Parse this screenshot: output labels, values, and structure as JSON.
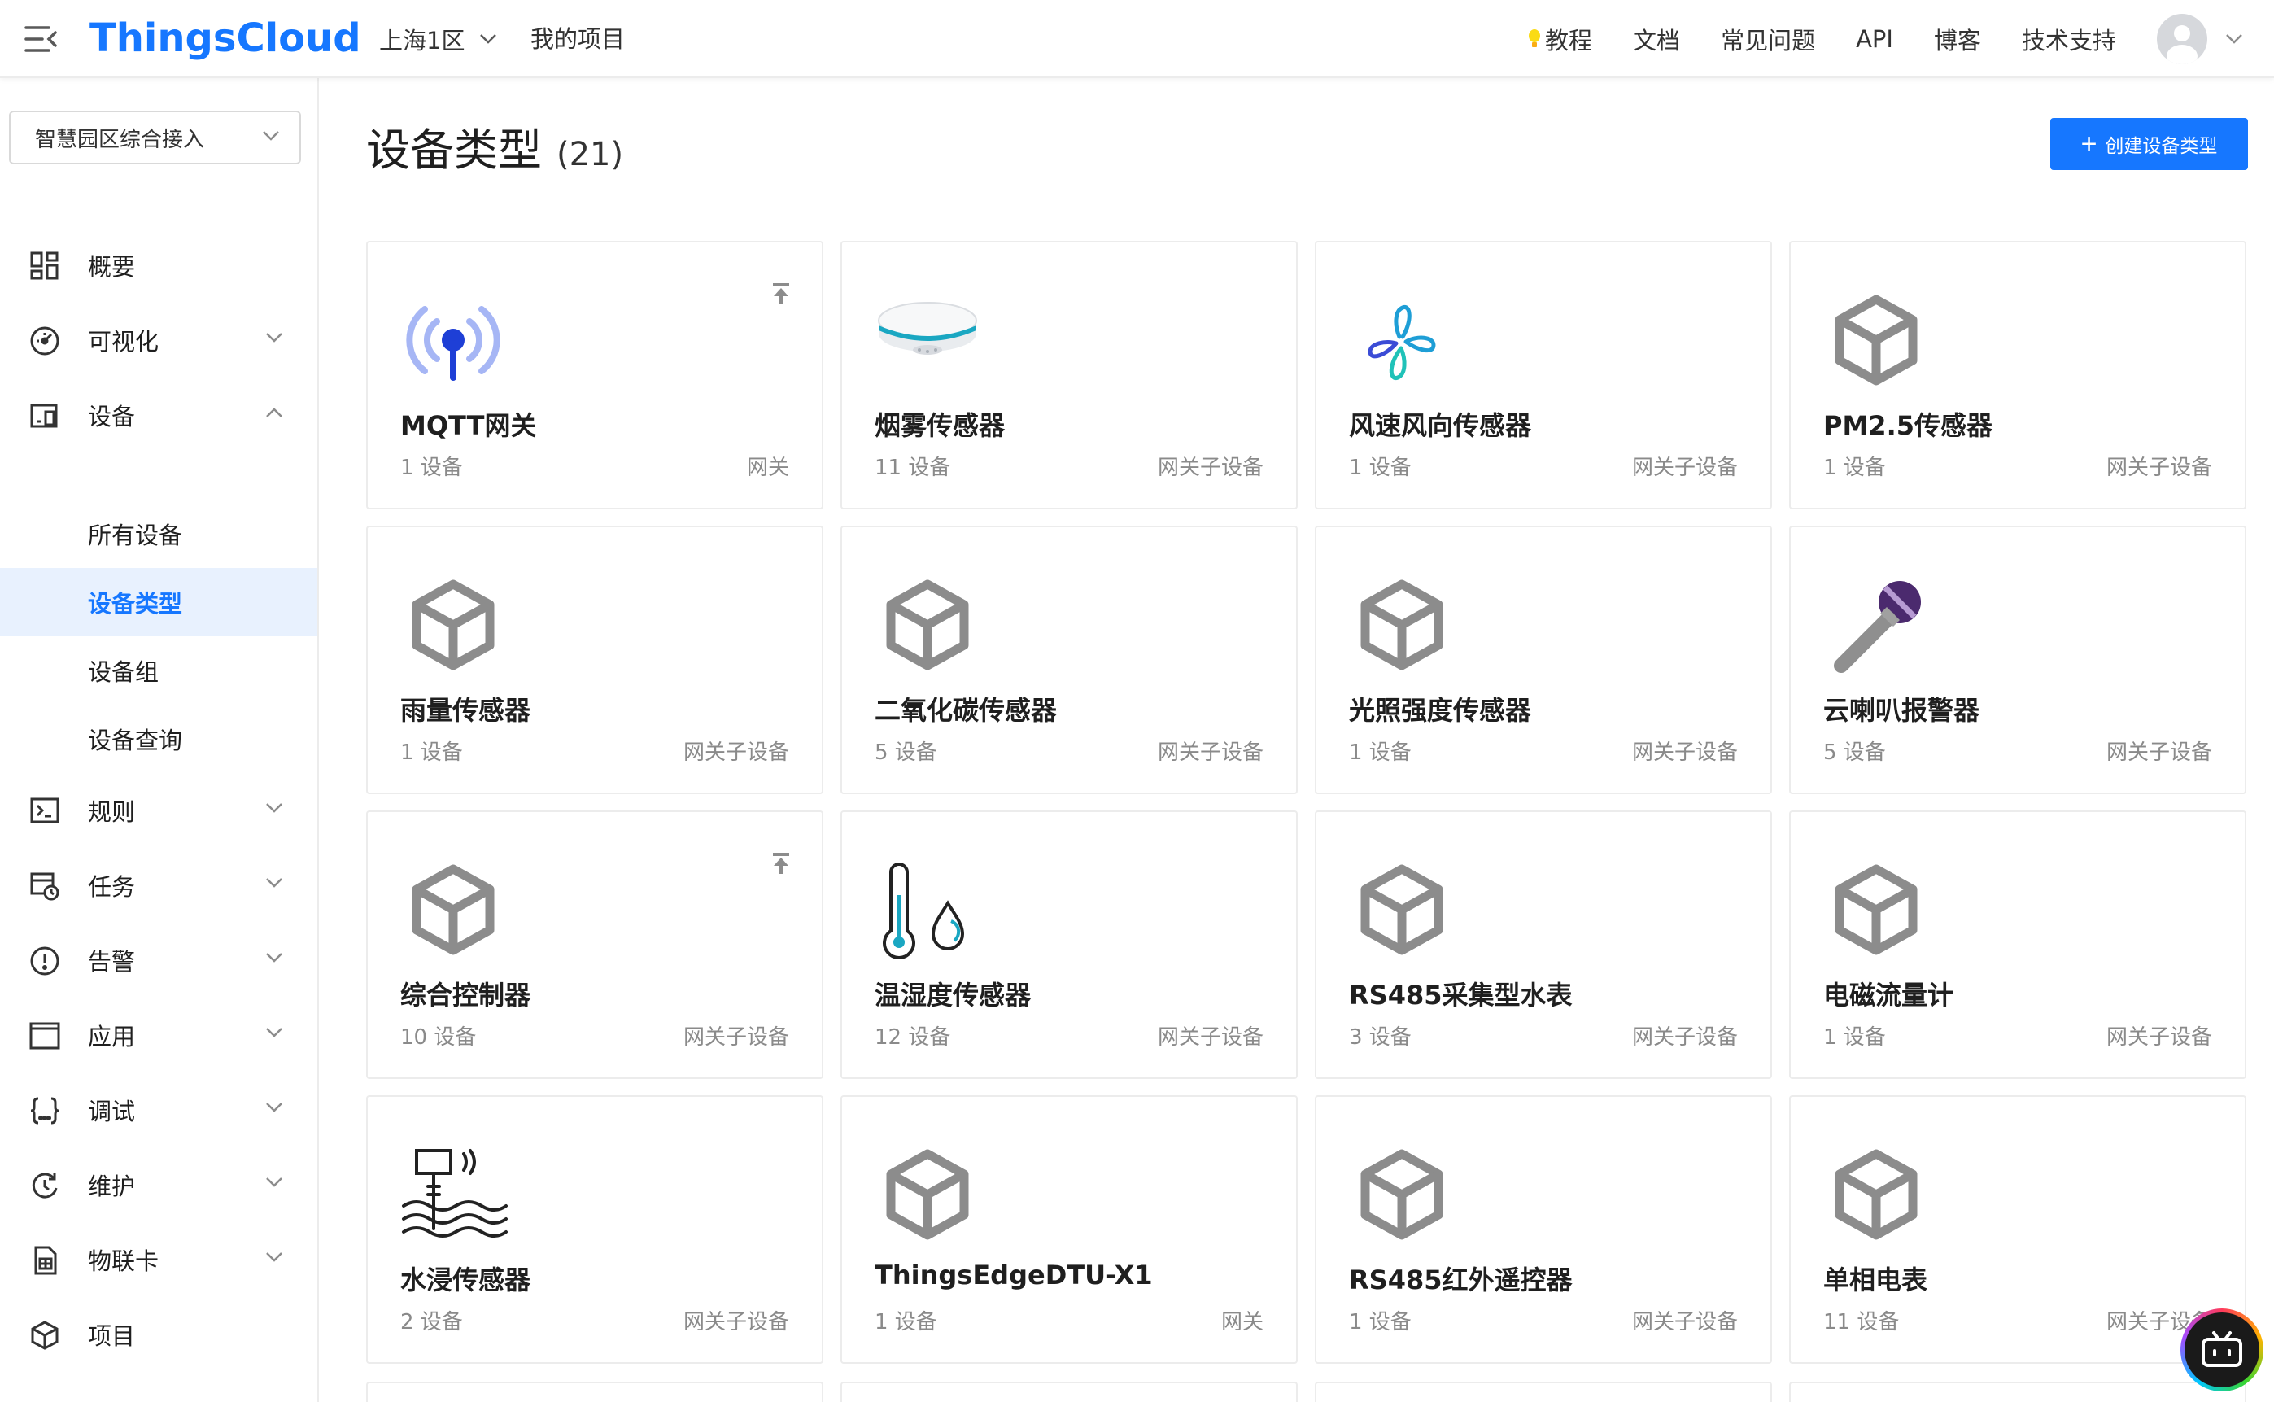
{
  "header": {
    "logo": "ThingsCloud",
    "region": "上海1区",
    "project_link": "我的项目",
    "nav": [
      {
        "label": "教程",
        "icon": "lightbulb-icon"
      },
      {
        "label": "文档"
      },
      {
        "label": "常见问题"
      },
      {
        "label": "API"
      },
      {
        "label": "博客"
      },
      {
        "label": "技术支持"
      }
    ]
  },
  "sidebar": {
    "project_select": "智慧园区综合接入",
    "items": [
      {
        "label": "概要",
        "icon": "dashboard-grid-icon"
      },
      {
        "label": "可视化",
        "icon": "gauge-icon"
      },
      {
        "label": "设备",
        "icon": "devices-icon"
      },
      {
        "label": "规则",
        "icon": "terminal-icon"
      },
      {
        "label": "任务",
        "icon": "task-calendar-icon"
      },
      {
        "label": "告警",
        "icon": "alert-circle-icon"
      },
      {
        "label": "应用",
        "icon": "window-icon"
      },
      {
        "label": "调试",
        "icon": "braces-icon"
      },
      {
        "label": "维护",
        "icon": "maintenance-icon"
      },
      {
        "label": "物联卡",
        "icon": "sim-card-icon"
      },
      {
        "label": "项目",
        "icon": "project-box-icon"
      }
    ],
    "device_sub": [
      "所有设备",
      "设备类型",
      "设备组",
      "设备查询"
    ],
    "active_sub": "设备类型"
  },
  "main": {
    "title": "设备类型",
    "count": "(21)",
    "create_button": "创建设备类型"
  },
  "cards": [
    {
      "name": "MQTT网关",
      "count": "1 设备",
      "type": "网关",
      "icon": "mqtt-antenna-icon",
      "pinned": true
    },
    {
      "name": "烟雾传感器",
      "count": "11 设备",
      "type": "网关子设备",
      "icon": "smoke-detector-icon",
      "pinned": false
    },
    {
      "name": "风速风向传感器",
      "count": "1 设备",
      "type": "网关子设备",
      "icon": "wind-fan-icon",
      "pinned": false
    },
    {
      "name": "PM2.5传感器",
      "count": "1 设备",
      "type": "网关子设备",
      "icon": "cube-icon",
      "pinned": false
    },
    {
      "name": "雨量传感器",
      "count": "1 设备",
      "type": "网关子设备",
      "icon": "cube-icon",
      "pinned": false
    },
    {
      "name": "二氧化碳传感器",
      "count": "5 设备",
      "type": "网关子设备",
      "icon": "cube-icon",
      "pinned": false
    },
    {
      "name": "光照强度传感器",
      "count": "1 设备",
      "type": "网关子设备",
      "icon": "cube-icon",
      "pinned": false
    },
    {
      "name": "云喇叭报警器",
      "count": "5 设备",
      "type": "网关子设备",
      "icon": "microphone-icon",
      "pinned": false
    },
    {
      "name": "综合控制器",
      "count": "10 设备",
      "type": "网关子设备",
      "icon": "cube-icon",
      "pinned": true
    },
    {
      "name": "温湿度传感器",
      "count": "12 设备",
      "type": "网关子设备",
      "icon": "thermometer-drop-icon",
      "pinned": false
    },
    {
      "name": "RS485采集型水表",
      "count": "3 设备",
      "type": "网关子设备",
      "icon": "cube-icon",
      "pinned": false
    },
    {
      "name": "电磁流量计",
      "count": "1 设备",
      "type": "网关子设备",
      "icon": "cube-icon",
      "pinned": false
    },
    {
      "name": "水浸传感器",
      "count": "2 设备",
      "type": "网关子设备",
      "icon": "water-immersion-icon",
      "pinned": false
    },
    {
      "name": "ThingsEdgeDTU-X1",
      "count": "1 设备",
      "type": "网关",
      "icon": "cube-icon",
      "pinned": false
    },
    {
      "name": "RS485红外遥控器",
      "count": "1 设备",
      "type": "网关子设备",
      "icon": "cube-icon",
      "pinned": false
    },
    {
      "name": "单相电表",
      "count": "11 设备",
      "type": "网关子设备",
      "icon": "cube-icon",
      "pinned": false
    }
  ],
  "colors": {
    "primary": "#1677ff",
    "active_bg": "#e8f1fe",
    "icon_gray": "#8c8c8c"
  }
}
